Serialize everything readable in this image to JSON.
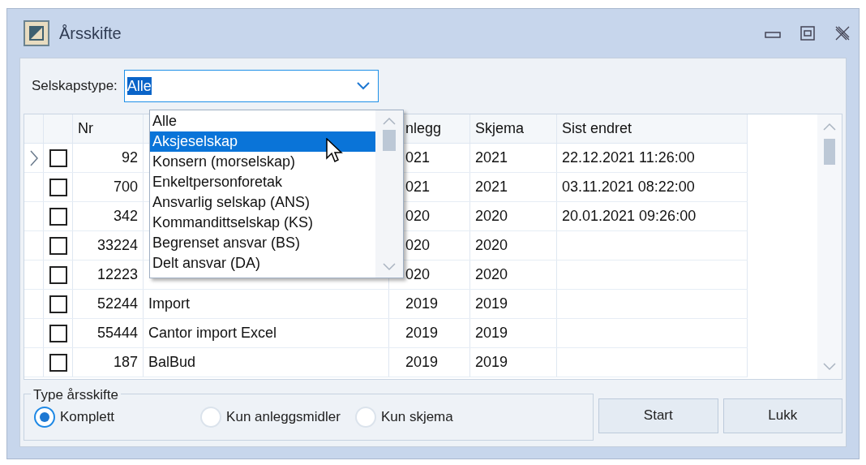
{
  "window": {
    "title": "Årsskifte"
  },
  "filter": {
    "label": "Selskapstype:",
    "value": "Alle"
  },
  "dropdown": {
    "items": [
      {
        "label": "Alle",
        "selected": false
      },
      {
        "label": "Aksjeselskap",
        "selected": true
      },
      {
        "label": "Konsern (morselskap)",
        "selected": false
      },
      {
        "label": "Enkeltpersonforetak",
        "selected": false
      },
      {
        "label": "Ansvarlig selskap (ANS)",
        "selected": false
      },
      {
        "label": "Kommandittselskap (KS)",
        "selected": false
      },
      {
        "label": "Begrenset ansvar (BS)",
        "selected": false
      },
      {
        "label": "Delt ansvar (DA)",
        "selected": false
      }
    ]
  },
  "table": {
    "columns": {
      "nr": "Nr",
      "column_4": "nlegg",
      "skjema": "Skjema",
      "sist_endret": "Sist endret"
    },
    "rows": [
      {
        "current": true,
        "checked": false,
        "nr": "92",
        "anlegg": "021",
        "skjema": "2021",
        "sist_endret": "22.12.2021 11:26:00"
      },
      {
        "current": false,
        "checked": false,
        "nr": "700",
        "anlegg": "021",
        "skjema": "2021",
        "sist_endret": "03.11.2021 08:22:00"
      },
      {
        "current": false,
        "checked": false,
        "nr": "342",
        "anlegg": "020",
        "skjema": "2020",
        "sist_endret": "20.01.2021 09:26:00"
      },
      {
        "current": false,
        "checked": false,
        "nr": "33224",
        "anlegg": "020",
        "skjema": "2020"
      },
      {
        "current": false,
        "checked": false,
        "nr": "12223",
        "anlegg": "020",
        "skjema": "2020"
      },
      {
        "current": false,
        "checked": false,
        "nr": "52244",
        "navn": "Import",
        "anlegg": "2019",
        "skjema": "2019"
      },
      {
        "current": false,
        "checked": false,
        "nr": "55444",
        "navn": "Cantor import Excel",
        "anlegg": "2019",
        "skjema": "2019"
      },
      {
        "current": false,
        "checked": false,
        "nr": "187",
        "navn": "BalBud",
        "anlegg": "2019",
        "skjema": "2019"
      }
    ]
  },
  "type_group": {
    "title": "Type årsskifte",
    "options": [
      {
        "label": "Komplett",
        "selected": true
      },
      {
        "label": "Kun anleggsmidler",
        "selected": false
      },
      {
        "label": "Kun skjema",
        "selected": false
      }
    ]
  },
  "buttons": [
    {
      "label": "Start"
    },
    {
      "label": "Lukk"
    }
  ]
}
